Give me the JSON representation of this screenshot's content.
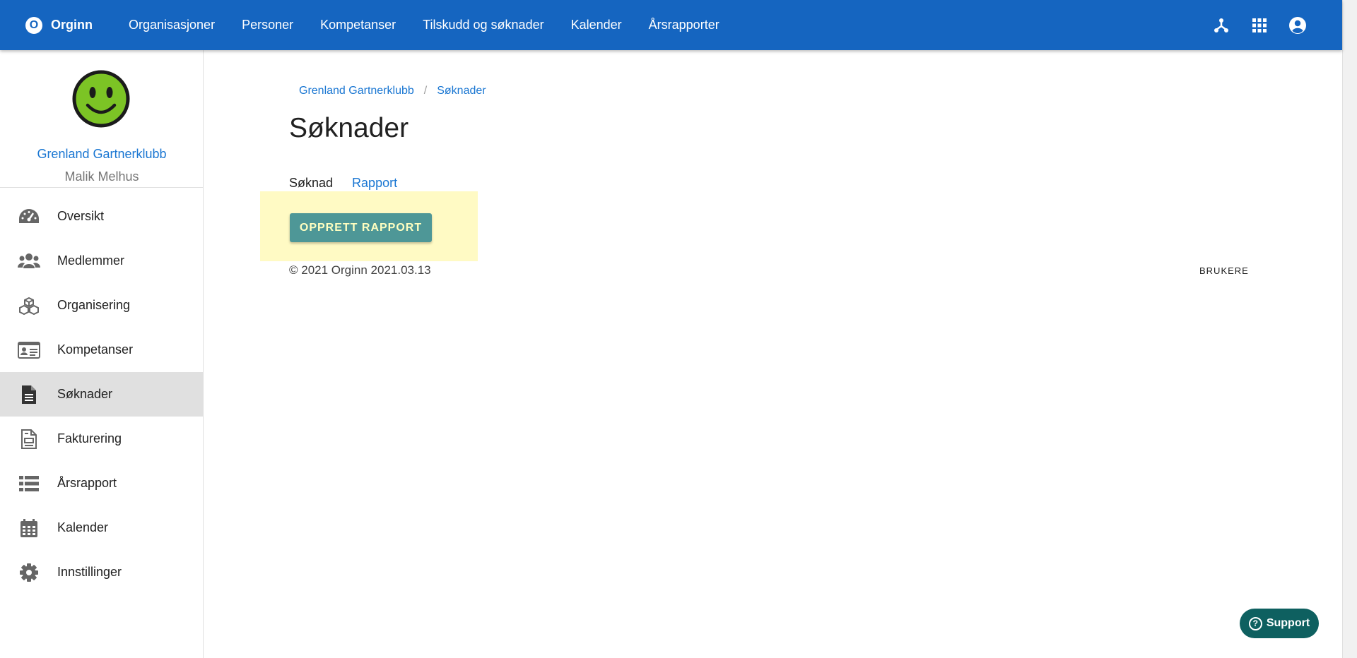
{
  "topbar": {
    "brand_letter": "O",
    "brand_name": "Orginn",
    "nav": [
      "Organisasjoner",
      "Personer",
      "Kompetanser",
      "Tilskudd og søknader",
      "Kalender",
      "Årsrapporter"
    ],
    "accent": "#1565c0"
  },
  "sidebar": {
    "club_name": "Grenland Gartnerklubb",
    "user_name": "Malik Melhus",
    "items": [
      {
        "label": "Oversikt",
        "icon": "dashboard-icon"
      },
      {
        "label": "Medlemmer",
        "icon": "people-icon"
      },
      {
        "label": "Organisering",
        "icon": "cubes-icon"
      },
      {
        "label": "Kompetanser",
        "icon": "id-card-icon"
      },
      {
        "label": "Søknader",
        "icon": "document-icon",
        "active": true
      },
      {
        "label": "Fakturering",
        "icon": "invoice-icon"
      },
      {
        "label": "Årsrapport",
        "icon": "list-icon"
      },
      {
        "label": "Kalender",
        "icon": "calendar-icon"
      },
      {
        "label": "Innstillinger",
        "icon": "gear-icon"
      }
    ]
  },
  "breadcrumb": {
    "items": [
      "Grenland Gartnerklubb",
      "Søknader"
    ],
    "separator": "/"
  },
  "main": {
    "title": "Søknader",
    "tabs": [
      {
        "label": "Søknad",
        "active": false
      },
      {
        "label": "Rapport",
        "active": true
      }
    ],
    "create_button": "OPPRETT RAPPORT"
  },
  "footer": {
    "copyright": "© 2021 Orginn 2021.03.13",
    "link": "BRUKERE"
  },
  "support": {
    "label": "Support"
  }
}
